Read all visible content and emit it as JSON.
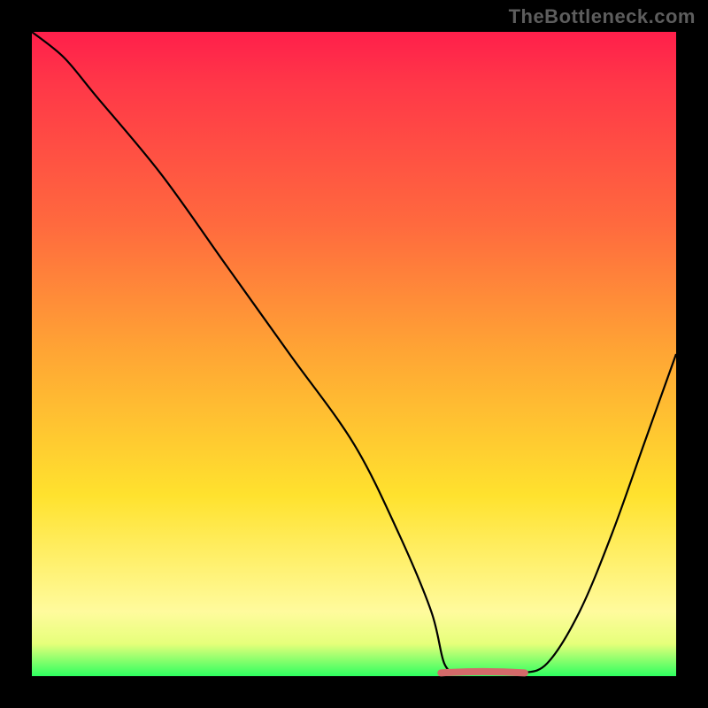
{
  "watermark": "TheBottleneck.com",
  "chart_data": {
    "type": "line",
    "title": "",
    "xlabel": "",
    "ylabel": "",
    "x_range": [
      0,
      100
    ],
    "y_range": [
      0,
      100
    ],
    "series": [
      {
        "name": "bottleneck-curve",
        "color": "#000000",
        "x": [
          0,
          5,
          10,
          20,
          30,
          40,
          50,
          57,
          62,
          64,
          66,
          68,
          72,
          76,
          80,
          85,
          90,
          95,
          100
        ],
        "y": [
          100,
          96,
          90,
          78,
          64,
          50,
          36,
          22,
          10,
          2,
          0.5,
          0.5,
          0.5,
          0.5,
          2,
          10,
          22,
          36,
          50
        ]
      },
      {
        "name": "optimal-zone-marker",
        "color": "#d46a6a",
        "x": [
          63.5,
          76.5
        ],
        "y": [
          0.5,
          0.5
        ]
      }
    ],
    "gradient_stops": [
      {
        "pos": 0.0,
        "color": "#ff1f4b"
      },
      {
        "pos": 0.3,
        "color": "#ff6a3e"
      },
      {
        "pos": 0.5,
        "color": "#ffa634"
      },
      {
        "pos": 0.72,
        "color": "#ffe22e"
      },
      {
        "pos": 0.9,
        "color": "#fffb9d"
      },
      {
        "pos": 1.0,
        "color": "#2eff60"
      }
    ]
  }
}
